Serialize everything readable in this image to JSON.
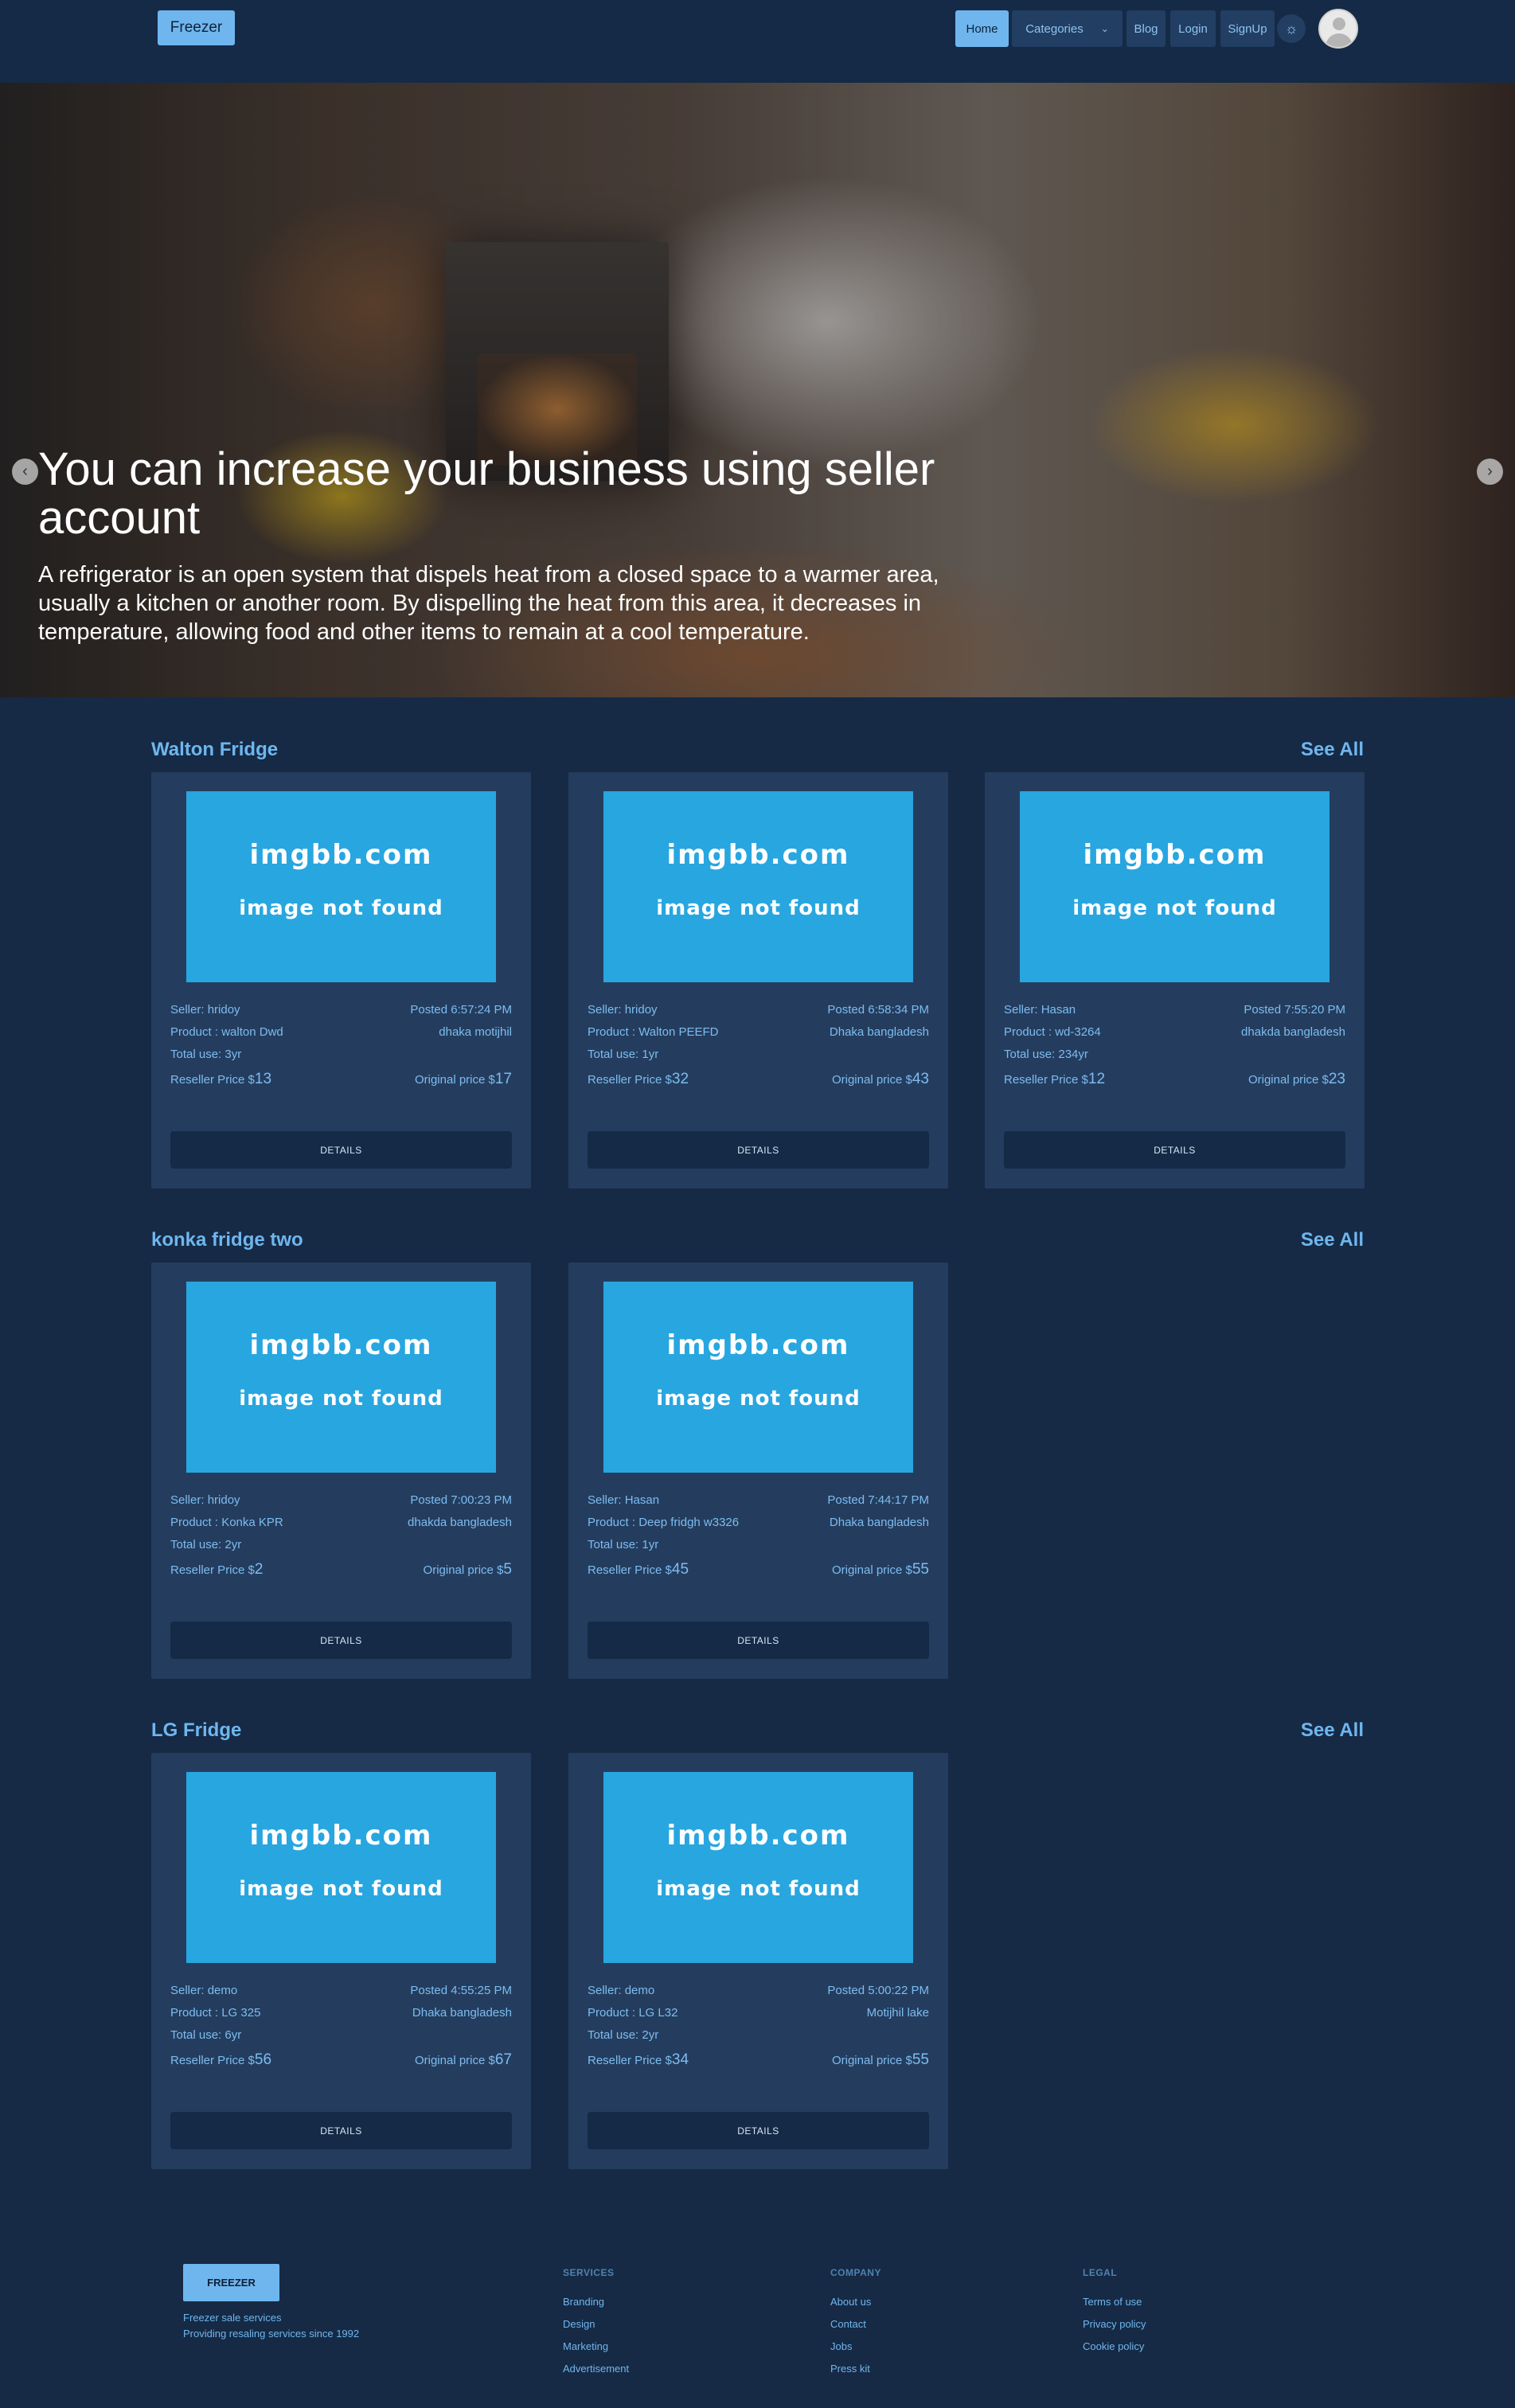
{
  "nav": {
    "brand": "Freezer",
    "home": "Home",
    "categories": "Categories",
    "blog": "Blog",
    "login": "Login",
    "signup": "SignUp",
    "theme_icon": "sun-icon",
    "avatar_icon": "user-avatar-icon"
  },
  "hero": {
    "title": "You can increase your business using seller account",
    "description": "A refrigerator is an open system that dispels heat from a closed space to a warmer area, usually a kitchen or another room. By dispelling the heat from this area, it decreases in temperature, allowing food and other items to remain at a cool temperature.",
    "prev_icon": "chevron-left-icon",
    "next_icon": "chevron-right-icon",
    "slides": 4,
    "active_slide": 1
  },
  "placeholder": {
    "line1": "imgbb.com",
    "line2": "image not found"
  },
  "card_labels": {
    "seller": "Seller: ",
    "product": "Product : ",
    "total_use": "Total use: ",
    "posted": "Posted ",
    "reseller": "Reseller Price $",
    "original": "Original price $",
    "details": "DETAILS"
  },
  "sections": [
    {
      "title": "Walton Fridge",
      "see_all": "See All",
      "cards": [
        {
          "seller": "hridoy",
          "product": "walton Dwd",
          "total_use": "3yr",
          "posted": "6:57:24 PM",
          "location": "dhaka motijhil",
          "reseller_price": "13",
          "original_price": "17"
        },
        {
          "seller": "hridoy",
          "product": "Walton PEEFD",
          "total_use": "1yr",
          "posted": "6:58:34 PM",
          "location": "Dhaka bangladesh",
          "reseller_price": "32",
          "original_price": "43"
        },
        {
          "seller": "Hasan",
          "product": "wd-3264",
          "total_use": "234yr",
          "posted": "7:55:20 PM",
          "location": "dhakda bangladesh",
          "reseller_price": "12",
          "original_price": "23"
        }
      ]
    },
    {
      "title": "konka fridge two",
      "see_all": "See All",
      "cards": [
        {
          "seller": "hridoy",
          "product": "Konka KPR",
          "total_use": "2yr",
          "posted": "7:00:23 PM",
          "location": "dhakda bangladesh",
          "reseller_price": "2",
          "original_price": "5"
        },
        {
          "seller": "Hasan",
          "product": "Deep fridgh w3326",
          "total_use": "1yr",
          "posted": "7:44:17 PM",
          "location": "Dhaka bangladesh",
          "reseller_price": "45",
          "original_price": "55"
        }
      ]
    },
    {
      "title": "LG Fridge",
      "see_all": "See All",
      "cards": [
        {
          "seller": "demo",
          "product": "LG 325",
          "total_use": "6yr",
          "posted": "4:55:25 PM",
          "location": "Dhaka bangladesh",
          "reseller_price": "56",
          "original_price": "67"
        },
        {
          "seller": "demo",
          "product": "LG L32",
          "total_use": "2yr",
          "posted": "5:00:22 PM",
          "location": "Motijhil lake",
          "reseller_price": "34",
          "original_price": "55"
        }
      ]
    }
  ],
  "footer": {
    "brand": "FREEZER",
    "tagline1": "Freezer sale services",
    "tagline2": "Providing resaling services since 1992",
    "columns": [
      {
        "heading": "SERVICES",
        "links": [
          "Branding",
          "Design",
          "Marketing",
          "Advertisement"
        ]
      },
      {
        "heading": "COMPANY",
        "links": [
          "About us",
          "Contact",
          "Jobs",
          "Press kit"
        ]
      },
      {
        "heading": "LEGAL",
        "links": [
          "Terms of use",
          "Privacy policy",
          "Cookie policy"
        ]
      }
    ]
  }
}
